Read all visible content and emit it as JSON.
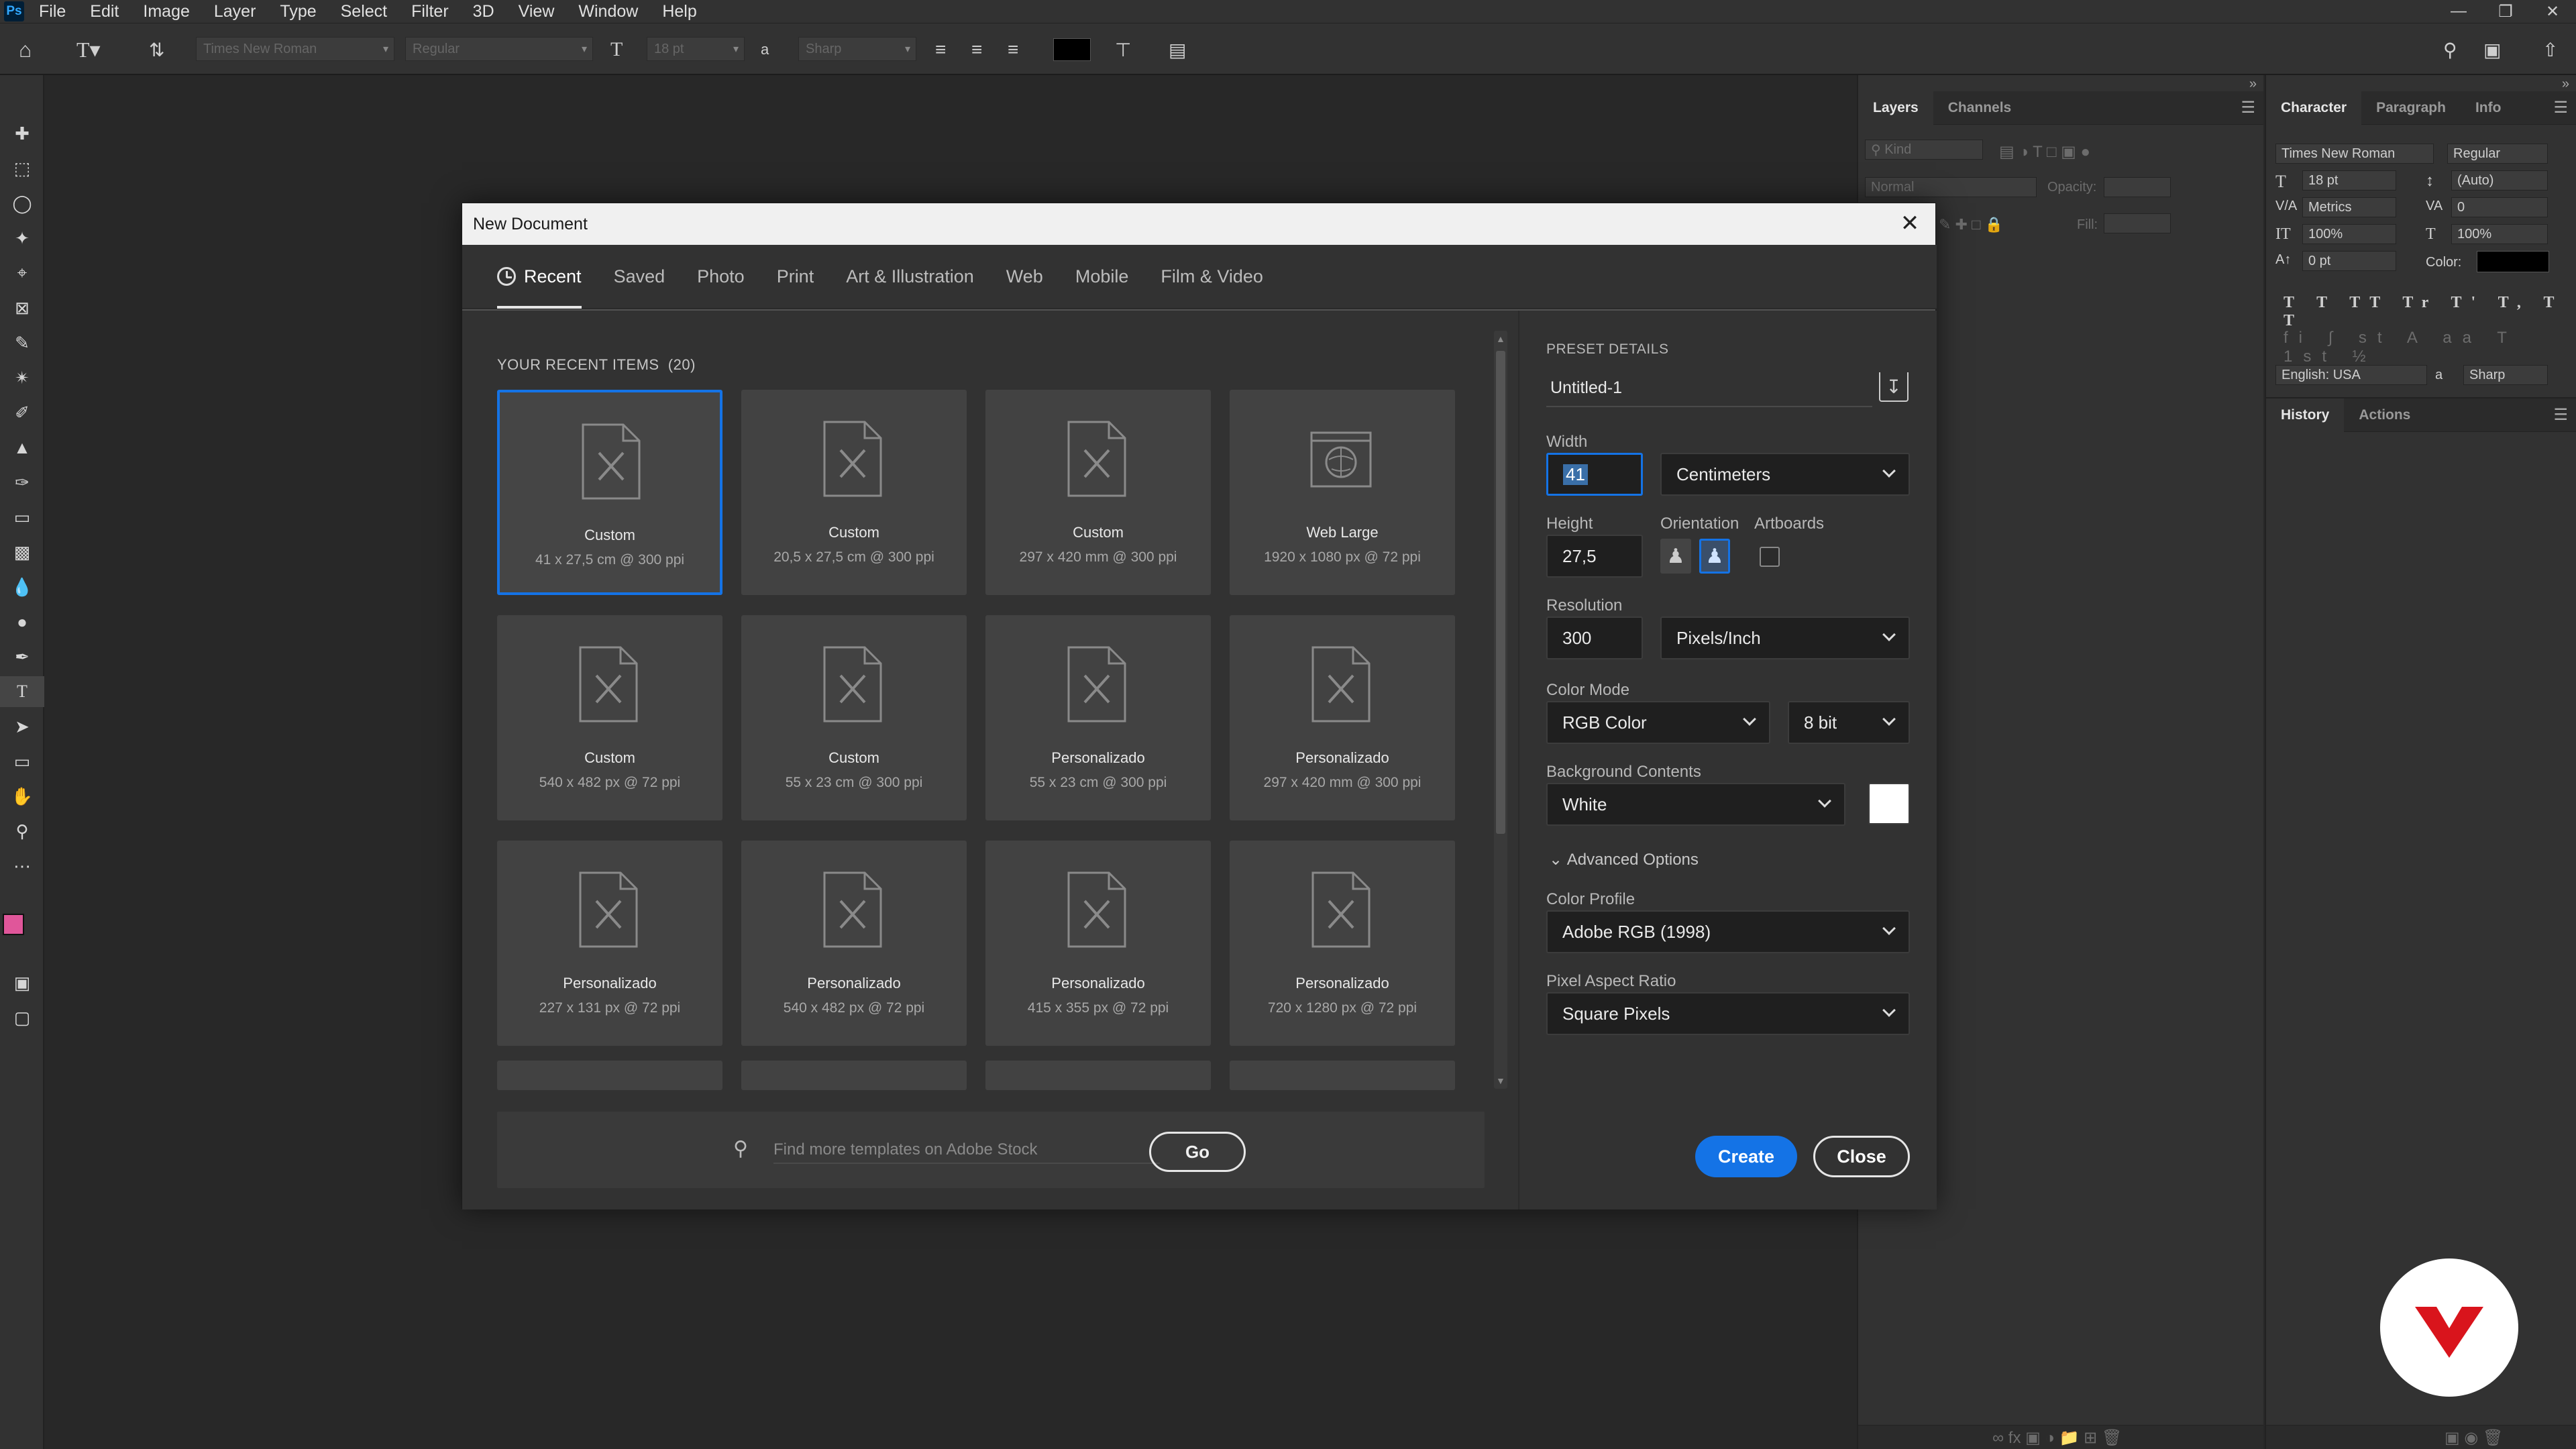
{
  "app": {
    "logo": "Ps"
  },
  "menu": [
    "File",
    "Edit",
    "Image",
    "Layer",
    "Type",
    "Select",
    "Filter",
    "3D",
    "View",
    "Window",
    "Help"
  ],
  "options_bar": {
    "font_family": "Times New Roman",
    "font_style": "Regular",
    "font_size": "18 pt",
    "antialias_label": "a",
    "antialias": "Sharp"
  },
  "layers_panel": {
    "tabs": [
      "Layers",
      "Channels"
    ],
    "kind_placeholder": "Kind",
    "blend": "Normal",
    "opacity_label": "Opacity:",
    "fill_label": "Fill:"
  },
  "character_panel": {
    "tabs": [
      "Character",
      "Paragraph",
      "Info"
    ],
    "font_family": "Times New Roman",
    "font_style": "Regular",
    "size": "18 pt",
    "leading": "(Auto)",
    "kerning": "Metrics",
    "tracking": "0",
    "vscale": "100%",
    "hscale": "100%",
    "baseline": "0 pt",
    "color_label": "Color:",
    "language": "English: USA",
    "antialias_label": "a",
    "antialias": "Sharp",
    "color": "#000000"
  },
  "history_panel": {
    "tabs": [
      "History",
      "Actions"
    ]
  },
  "dialog": {
    "title": "New Document",
    "tabs": [
      "Recent",
      "Saved",
      "Photo",
      "Print",
      "Art & Illustration",
      "Web",
      "Mobile",
      "Film & Video"
    ],
    "recent_heading": "YOUR RECENT ITEMS",
    "recent_count": "(20)",
    "items": [
      {
        "name": "Custom",
        "size": "41 x 27,5 cm @ 300 ppi",
        "icon": "document-icon"
      },
      {
        "name": "Custom",
        "size": "20,5 x 27,5 cm @ 300 ppi",
        "icon": "document-icon"
      },
      {
        "name": "Custom",
        "size": "297 x 420 mm @ 300 ppi",
        "icon": "document-icon"
      },
      {
        "name": "Web Large",
        "size": "1920 x 1080 px @ 72 ppi",
        "icon": "web-icon"
      },
      {
        "name": "Custom",
        "size": "540 x 482 px @ 72 ppi",
        "icon": "document-icon"
      },
      {
        "name": "Custom",
        "size": "55 x 23 cm @ 300 ppi",
        "icon": "document-icon"
      },
      {
        "name": "Personalizado",
        "size": "55 x 23 cm @ 300 ppi",
        "icon": "document-icon"
      },
      {
        "name": "Personalizado",
        "size": "297 x 420 mm @ 300 ppi",
        "icon": "document-icon"
      },
      {
        "name": "Personalizado",
        "size": "227 x 131 px @ 72 ppi",
        "icon": "document-icon"
      },
      {
        "name": "Personalizado",
        "size": "540 x 482 px @ 72 ppi",
        "icon": "document-icon"
      },
      {
        "name": "Personalizado",
        "size": "415 x 355 px @ 72 ppi",
        "icon": "document-icon"
      },
      {
        "name": "Personalizado",
        "size": "720 x 1280 px @ 72 ppi",
        "icon": "document-icon"
      }
    ],
    "stock_placeholder": "Find more templates on Adobe Stock",
    "go_label": "Go",
    "preset": {
      "heading": "PRESET DETAILS",
      "name": "Untitled-1",
      "width_label": "Width",
      "width": "41",
      "width_unit": "Centimeters",
      "height_label": "Height",
      "height": "27,5",
      "orientation_label": "Orientation",
      "artboards_label": "Artboards",
      "resolution_label": "Resolution",
      "resolution": "300",
      "resolution_unit": "Pixels/Inch",
      "color_mode_label": "Color Mode",
      "color_mode": "RGB Color",
      "bit_depth": "8 bit",
      "bg_label": "Background Contents",
      "bg": "White",
      "bg_color": "#ffffff",
      "advanced_label": "Advanced Options",
      "profile_label": "Color Profile",
      "profile": "Adobe RGB (1998)",
      "par_label": "Pixel Aspect Ratio",
      "par": "Square Pixels"
    },
    "create_label": "Create",
    "close_label": "Close"
  },
  "colors": {
    "accent": "#1473e6",
    "foreground_swatch": "#e0569a",
    "background_swatch": "#ffffff",
    "brand_logo": "#d9141c"
  }
}
